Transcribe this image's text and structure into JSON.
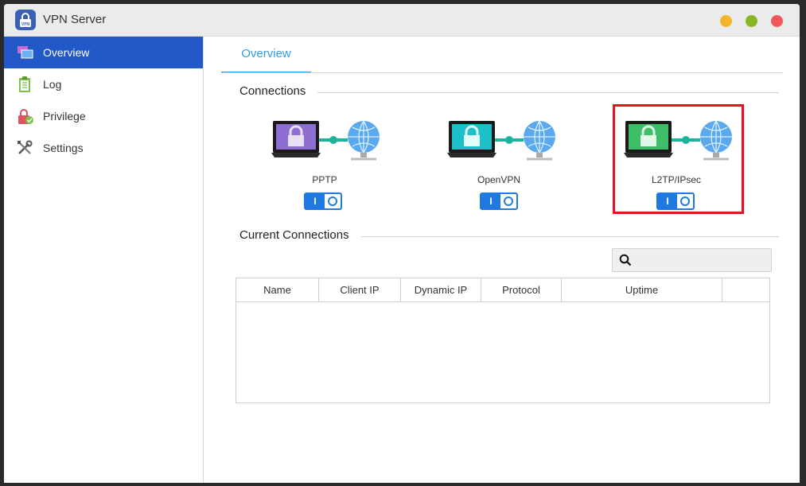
{
  "window": {
    "title": "VPN Server"
  },
  "sidebar": {
    "items": [
      {
        "label": "Overview",
        "icon": "overview-icon",
        "active": true
      },
      {
        "label": "Log",
        "icon": "log-icon"
      },
      {
        "label": "Privilege",
        "icon": "privilege-icon"
      },
      {
        "label": "Settings",
        "icon": "settings-icon"
      }
    ]
  },
  "tabs": {
    "overview": "Overview"
  },
  "connections": {
    "title": "Connections",
    "items": [
      {
        "label": "PPTP",
        "enabled": true,
        "screen_color": "#8e6fd1"
      },
      {
        "label": "OpenVPN",
        "enabled": true,
        "screen_color": "#1ec0c8"
      },
      {
        "label": "L2TP/IPsec",
        "enabled": true,
        "screen_color": "#3fbe6a",
        "highlighted": true
      }
    ],
    "toggle_on_text": "I"
  },
  "current_connections": {
    "title": "Current Connections",
    "search_placeholder": "",
    "columns": [
      "Name",
      "Client IP",
      "Dynamic IP",
      "Protocol",
      "Uptime",
      ""
    ],
    "rows": []
  },
  "colors": {
    "accent": "#2358c8",
    "tab": "#2e9bef",
    "toggle": "#1e7ae0",
    "highlight": "#e1141e"
  }
}
